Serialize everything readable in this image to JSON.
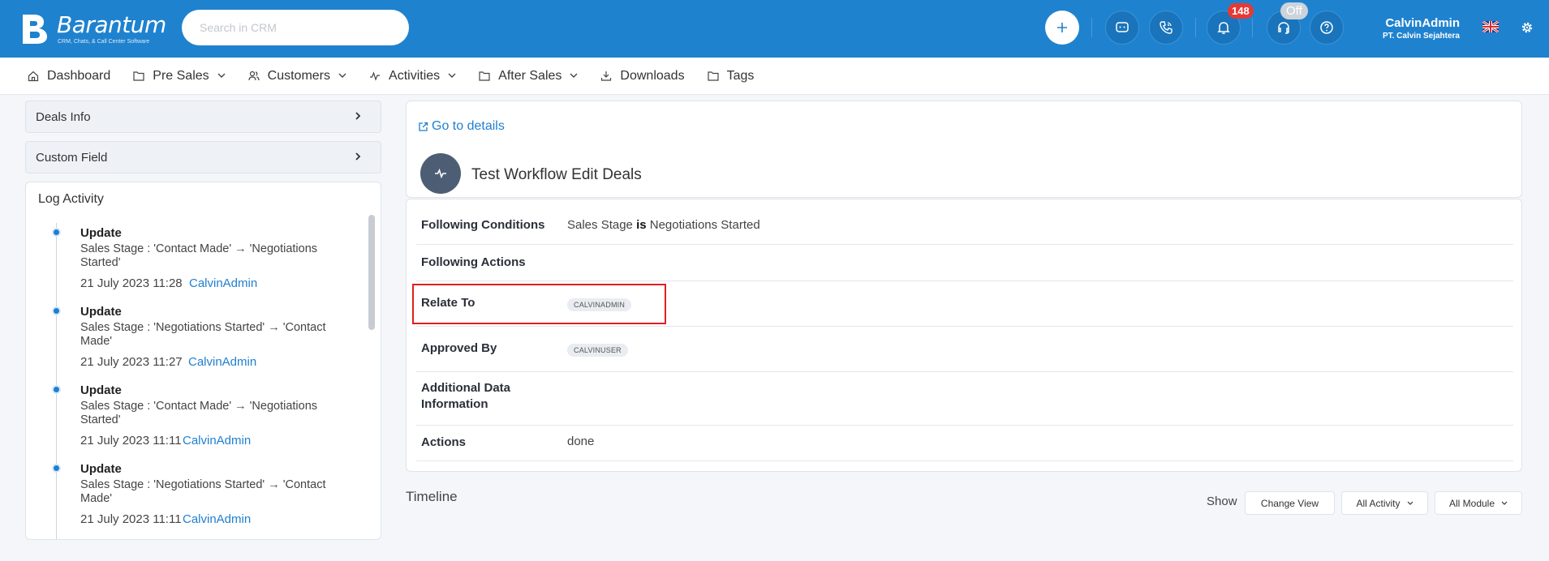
{
  "brand": {
    "name": "Barantum",
    "tagline": "CRM, Chats, & Call Center Software"
  },
  "search": {
    "placeholder": "Search in CRM",
    "value": ""
  },
  "header": {
    "notification_count": "148",
    "call_status": "Off",
    "user_name": "CalvinAdmin",
    "company": "PT. Calvin Sejahtera"
  },
  "nav": {
    "items": [
      {
        "label": "Dashboard"
      },
      {
        "label": "Pre Sales"
      },
      {
        "label": "Customers"
      },
      {
        "label": "Activities"
      },
      {
        "label": "After Sales"
      },
      {
        "label": "Downloads"
      },
      {
        "label": "Tags"
      }
    ]
  },
  "left": {
    "deals_info": "Deals Info",
    "custom_field": "Custom Field",
    "log_title": "Log Activity",
    "entries": [
      {
        "title": "Update",
        "desc": "Sales Stage : 'Contact Made' → 'Negotiations Started'",
        "date": "21 July 2023 11:28",
        "user": "CalvinAdmin"
      },
      {
        "title": "Update",
        "desc": "Sales Stage : 'Negotiations Started' → 'Contact Made'",
        "date": "21 July 2023 11:27",
        "user": "CalvinAdmin"
      },
      {
        "title": "Update",
        "desc": "Sales Stage : 'Contact Made' → 'Negotiations Started'",
        "date": "21 July 2023 11:11",
        "user": "CalvinAdmin"
      },
      {
        "title": "Update",
        "desc": "Sales Stage : 'Negotiations Started' → 'Contact Made'",
        "date": "21 July 2023 11:11",
        "user": "CalvinAdmin"
      }
    ]
  },
  "workflow": {
    "goto": "Go to details",
    "title": "Test Workflow Edit Deals",
    "conditions_label": "Following Conditions",
    "cond_field": "Sales Stage",
    "cond_op": "is",
    "cond_value": "Negotiations Started",
    "actions_label": "Following Actions",
    "relate_label": "Relate To",
    "relate_value": "CALVINADMIN",
    "approved_label": "Approved By",
    "approved_value": "CALVINUSER",
    "additional_label_1": "Additional Data",
    "additional_label_2": "Information",
    "actions_row_label": "Actions",
    "actions_row_value": "done"
  },
  "timeline": {
    "title": "Timeline",
    "show": "Show",
    "change_view": "Change View",
    "all_activity": "All Activity",
    "all_module": "All Module"
  }
}
